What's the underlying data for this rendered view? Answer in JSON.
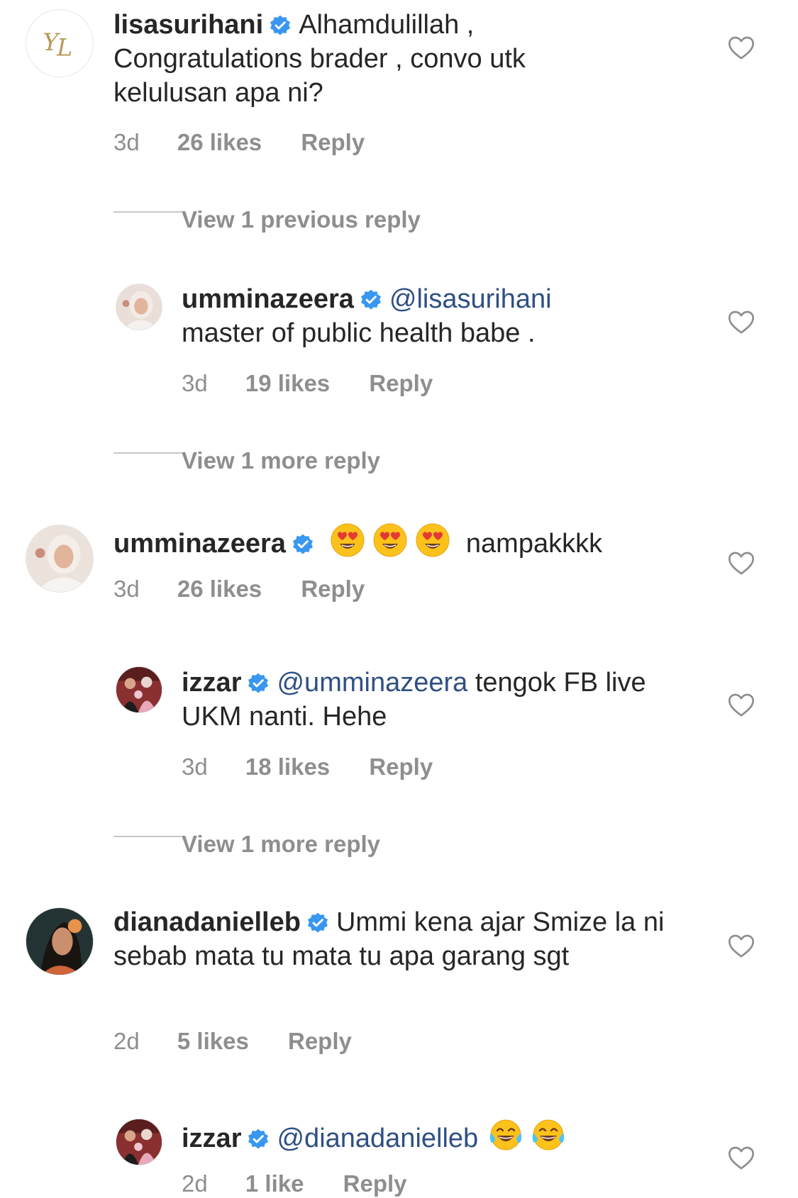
{
  "comments": [
    {
      "username": "lisasurihani",
      "text": "Alhamdulillah , Congratulations brader , convo utk kelulusan apa ni?",
      "time": "3d",
      "likes": "26 likes",
      "reply": "Reply"
    },
    {
      "username": "umminazeera",
      "mention": "@lisasurihani",
      "text": "master of public health babe .",
      "time": "3d",
      "likes": "19 likes",
      "reply": "Reply"
    },
    {
      "username": "umminazeera",
      "text": "nampakkkk",
      "time": "3d",
      "likes": "26 likes",
      "reply": "Reply"
    },
    {
      "username": "izzar",
      "mention": "@umminazeera",
      "text": "tengok FB live UKM nanti. Hehe",
      "time": "3d",
      "likes": "18 likes",
      "reply": "Reply"
    },
    {
      "username": "dianadanielleb",
      "text": "Ummi kena ajar Smize la ni sebab mata tu mata tu apa garang sgt",
      "time": "2d",
      "likes": "5 likes",
      "reply": "Reply"
    },
    {
      "username": "izzar",
      "mention": "@dianadanielleb",
      "time": "2d",
      "likes": "1 like",
      "reply": "Reply"
    }
  ],
  "view_replies": [
    "View 1 previous reply",
    "View 1 more reply",
    "View 1 more reply"
  ],
  "icons": {
    "verified": "verified-badge-icon",
    "like": "heart-outline-icon",
    "heart_eyes": "heart-eyes-emoji",
    "tears_of_joy": "tears-of-joy-emoji"
  },
  "colors": {
    "verified": "#3897f0",
    "mention": "#2f4f86",
    "secondary_text": "#8e8e8e",
    "text": "#262626"
  }
}
